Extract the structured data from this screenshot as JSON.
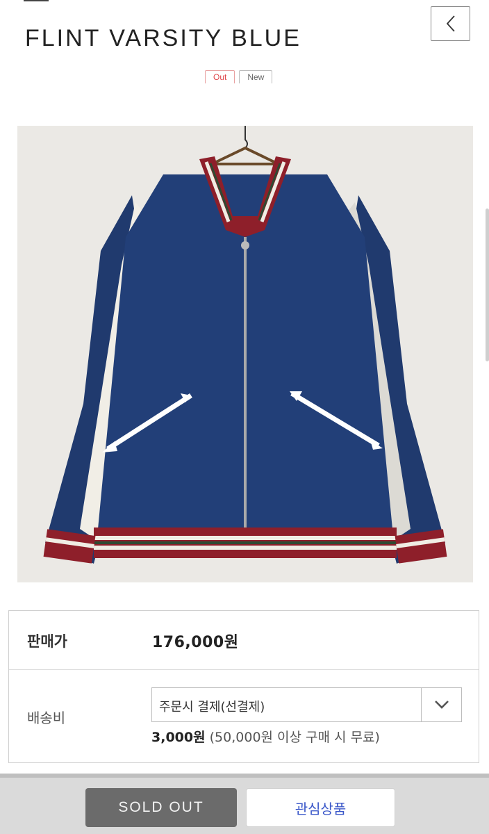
{
  "product": {
    "title": "FLINT VARSITY BLUE",
    "badges": [
      "Out",
      "New"
    ],
    "image_subject": "navy and white satin varsity bomber jacket with red and green striped ribbing and white arrow embroidery on a wall hanger"
  },
  "nav": {
    "back_icon": "chevron-left-icon"
  },
  "info": {
    "price_label": "판매가",
    "price": "176,000원",
    "shipping_label": "배송비",
    "shipping_select": "주문시 결제(선결제)",
    "shipping_fee": "3,000원",
    "shipping_note": "(50,000원 이상 구매 시 무료)"
  },
  "actions": {
    "sold_out": "SOLD OUT",
    "wishlist": "관심상품"
  },
  "colors": {
    "out_badge": "#e0454a",
    "sold_out_bg": "#6b6b6b",
    "wishlist_text": "#3a57c9",
    "jacket_navy": "#203a6e",
    "rib_red": "#8e1f2a"
  }
}
